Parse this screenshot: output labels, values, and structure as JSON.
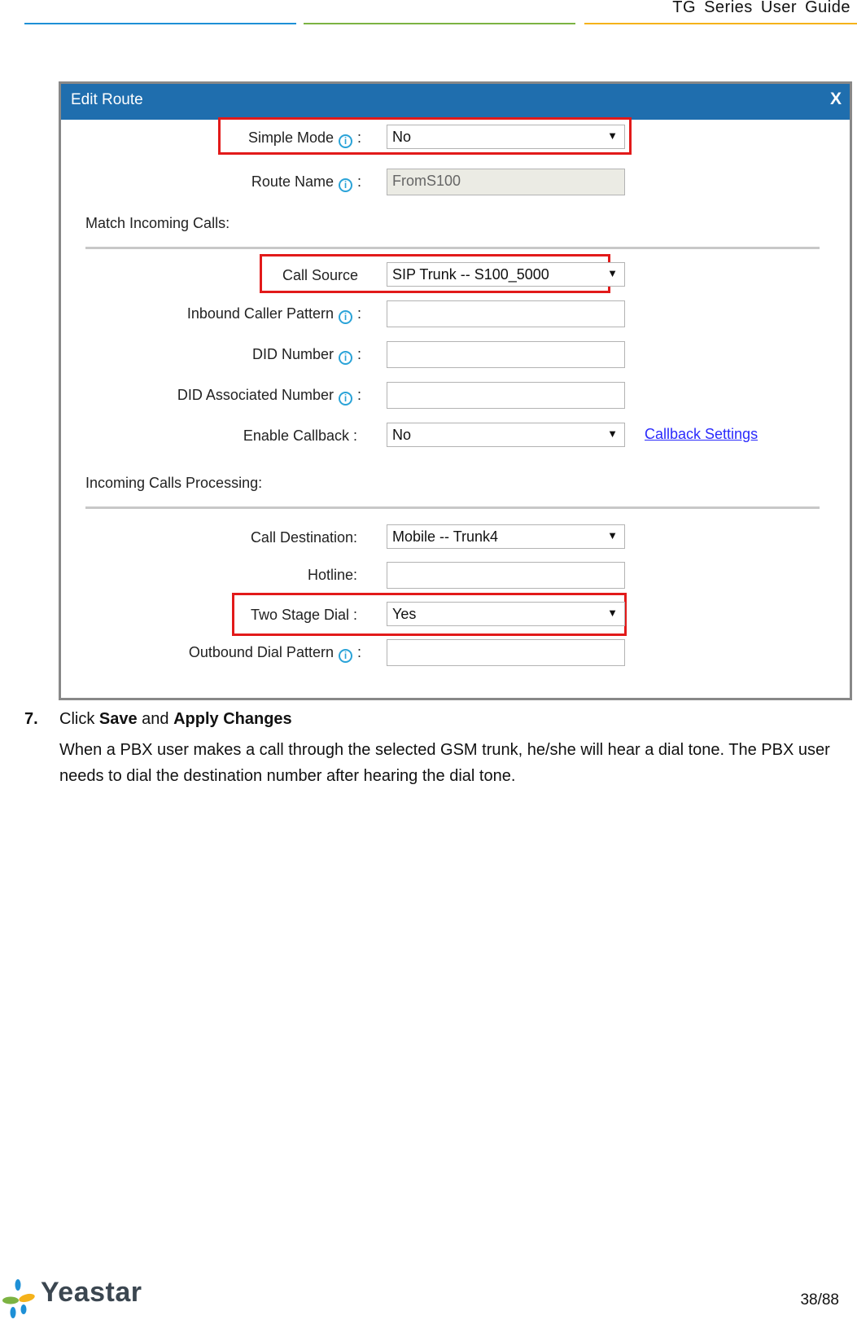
{
  "doc_header": {
    "title": "TG Series User Guide",
    "rule_colors": [
      "#1e90d6",
      "#7cb342",
      "#f5b21a"
    ]
  },
  "dialog": {
    "title": "Edit Route",
    "close_label": "X",
    "header_color": "#1f6eae",
    "highlight_color": "#e21a1a",
    "fields": {
      "simple_mode": {
        "label": "Simple Mode",
        "value": "No",
        "info_icon": true
      },
      "route_name": {
        "label": "Route Name",
        "value": "FromS100",
        "info_icon": true
      },
      "call_source": {
        "label": "Call Source",
        "value": "SIP Trunk -- S100_5000"
      },
      "inbound_caller_pattern": {
        "label": "Inbound Caller Pattern",
        "value": "",
        "info_icon": true
      },
      "did_number": {
        "label": "DID Number",
        "value": "",
        "info_icon": true
      },
      "did_associated_number": {
        "label": "DID Associated Number",
        "value": "",
        "info_icon": true
      },
      "enable_callback": {
        "label": "Enable Callback :",
        "value": "No"
      },
      "call_destination": {
        "label": "Call Destination:",
        "value": "Mobile -- Trunk4"
      },
      "hotline": {
        "label": "Hotline:",
        "value": ""
      },
      "two_stage_dial": {
        "label": "Two Stage Dial :",
        "value": "Yes"
      },
      "outbound_dial_pattern": {
        "label": "Outbound Dial Pattern",
        "value": "",
        "info_icon": true
      }
    },
    "sections": {
      "match_incoming": "Match Incoming Calls:",
      "incoming_processing": "Incoming Calls Processing:"
    },
    "callback_settings_link": "Callback Settings",
    "colon": ":",
    "info_glyph": "i",
    "caret_glyph": "▼"
  },
  "step": {
    "number": "7.",
    "prefix": "Click ",
    "save": "Save",
    "and": " and ",
    "apply": "Apply Changes",
    "body": "When a PBX user makes a call through the selected GSM trunk, he/she will hear a dial tone. The PBX user needs to dial the destination number after hearing the dial tone."
  },
  "footer": {
    "logo_text": "Yeastar",
    "page_number": "38/88"
  }
}
